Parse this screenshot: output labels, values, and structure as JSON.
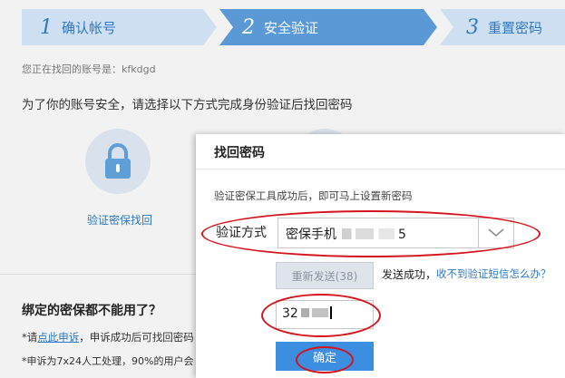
{
  "steps": [
    {
      "num": "1",
      "label": "确认帐号"
    },
    {
      "num": "2",
      "label": "安全验证"
    },
    {
      "num": "3",
      "label": "重置密码"
    }
  ],
  "account_line": "您正在找回的账号是：kfkdgd",
  "instruction": "为了你的账号安全，请选择以下方式完成身份验证后找回密码",
  "method": {
    "label": "验证密保找回",
    "icon": "lock-icon"
  },
  "bound_section": {
    "title": "绑定的密保都不能用了？",
    "line1_prefix": "*请",
    "line1_link": "点此申诉",
    "line1_suffix": "，申诉成功后可找回密码",
    "line2": "*申诉为7x24人工处理，90%的用户会"
  },
  "dialog": {
    "title": "找回密码",
    "description": "验证密保工具成功后，即可马上设置新密码",
    "method_label": "验证方式",
    "method_value": "密保手机",
    "method_value_tail": "5",
    "resend_label": "重新发送(38)",
    "sent_text": "发送成功，",
    "no_sms_link": "收不到验证短信怎么办？",
    "code_value": "32",
    "confirm_label": "确定"
  },
  "colors": {
    "accent": "#2f78c3",
    "active_step": "#5a99d6",
    "annotation": "#d4141c"
  }
}
